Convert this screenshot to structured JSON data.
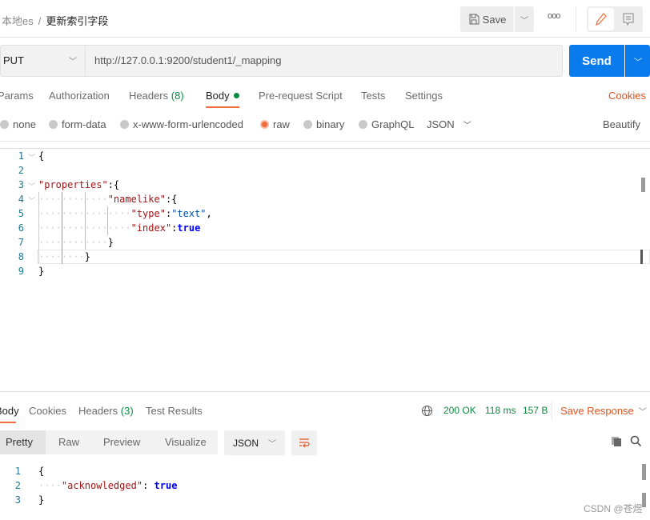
{
  "header": {
    "breadcrumb_parent": "本地es",
    "breadcrumb_current": "更新索引字段",
    "save_label": "Save"
  },
  "request": {
    "method": "PUT",
    "url": "http://127.0.0.1:9200/student1/_mapping",
    "send_label": "Send"
  },
  "tabs": [
    {
      "label": "Params"
    },
    {
      "label": "Authorization"
    },
    {
      "label": "Headers",
      "count": "(8)"
    },
    {
      "label": "Body",
      "active": true
    },
    {
      "label": "Pre-request Script"
    },
    {
      "label": "Tests"
    },
    {
      "label": "Settings"
    }
  ],
  "cookies_label": "Cookies",
  "body_types": [
    {
      "label": "none"
    },
    {
      "label": "form-data"
    },
    {
      "label": "x-www-form-urlencoded"
    },
    {
      "label": "raw",
      "selected": true
    },
    {
      "label": "binary"
    },
    {
      "label": "GraphQL"
    }
  ],
  "body_format": "JSON",
  "beautify_label": "Beautify",
  "request_body_line_numbers": [
    "1",
    "2",
    "3",
    "4",
    "5",
    "6",
    "7",
    "8",
    "9"
  ],
  "request_body": {
    "l1": "{",
    "l3_key": "\"properties\"",
    "l3_rest": ":{",
    "l4_key": "\"namelike\"",
    "l4_rest": ":{",
    "l5_key": "\"type\"",
    "l5_colon": ":",
    "l5_val": "\"text\"",
    "l5_comma": ",",
    "l6_key": "\"index\"",
    "l6_colon": ":",
    "l6_val": "true",
    "l7": "}",
    "l8": "}",
    "l9": "}"
  },
  "response": {
    "tabs": [
      {
        "label": "Body",
        "active": true
      },
      {
        "label": "Cookies"
      },
      {
        "label": "Headers",
        "count": "(3)"
      },
      {
        "label": "Test Results"
      }
    ],
    "status": "200 OK",
    "time": "118 ms",
    "size": "157 B",
    "save_label": "Save Response",
    "views": [
      "Pretty",
      "Raw",
      "Preview",
      "Visualize"
    ],
    "format": "JSON",
    "line_numbers": [
      "1",
      "2",
      "3"
    ],
    "body": {
      "l1": "{",
      "l2_key": "\"acknowledged\"",
      "l2_colon": ": ",
      "l2_val": "true",
      "l3": "}"
    }
  },
  "watermark": "CSDN @苍煜",
  "colors": {
    "accent": "#f26b3a",
    "send": "#097bed",
    "success": "#0b8a3e"
  }
}
